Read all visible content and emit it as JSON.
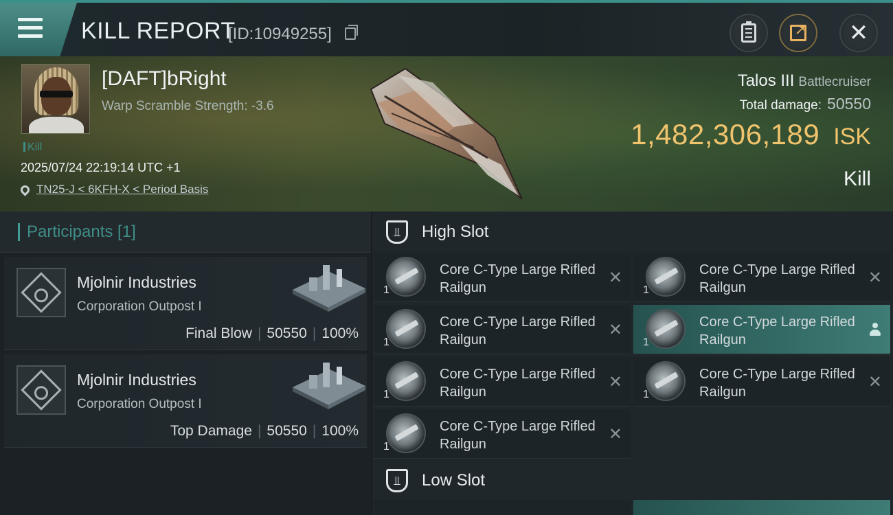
{
  "header": {
    "title": "KILL REPORT",
    "report_id": "[ID:10949255]"
  },
  "victim": {
    "pilot_name": "[DAFT]bRight",
    "warp_scramble": "Warp Scramble Strength: -3.6",
    "tag": "Kill",
    "timestamp": "2025/07/24 22:19:14 UTC +1",
    "location": "TN25-J < 6KFH-X < Period Basis"
  },
  "ship": {
    "name": "Talos III",
    "class": "Battlecruiser",
    "total_damage_label": "Total damage:",
    "total_damage": "50550",
    "isk_value": "1,482,306,189",
    "isk_unit": "ISK",
    "result": "Kill"
  },
  "participants": {
    "title": "Participants [1]",
    "items": [
      {
        "name": "Mjolnir Industries",
        "subtitle": "Corporation Outpost I",
        "role": "Final Blow",
        "damage": "50550",
        "percent": "100%"
      },
      {
        "name": "Mjolnir Industries",
        "subtitle": "Corporation Outpost I",
        "role": "Top Damage",
        "damage": "50550",
        "percent": "100%"
      }
    ]
  },
  "fitting": {
    "high_slot_title": "High Slot",
    "low_slot_title": "Low Slot",
    "modules": [
      {
        "name": "Core C-Type Large Rifled Railgun",
        "qty": "1"
      },
      {
        "name": "Core C-Type Large Rifled Railgun",
        "qty": "1"
      },
      {
        "name": "Core C-Type Large Rifled Railgun",
        "qty": "1"
      },
      {
        "name": "Core C-Type Large Rifled Railgun",
        "qty": "1"
      },
      {
        "name": "Core C-Type Large Rifled Railgun",
        "qty": "1"
      },
      {
        "name": "Core C-Type Large Rifled Railgun",
        "qty": "1"
      },
      {
        "name": "Core C-Type Large Rifled Railgun",
        "qty": "1"
      }
    ]
  },
  "icons": {
    "menu": "hamburger-icon",
    "copy": "copy-icon",
    "clipboard": "clipboard-icon",
    "share": "share-icon",
    "close": "close-icon",
    "location": "location-pin-icon",
    "slot": "slot-shield-icon",
    "remove": "close-x-icon",
    "user": "person-icon"
  },
  "colors": {
    "accent_teal": "#3f8e87",
    "isk_gold": "#f0c36d",
    "selected_row": "#3f7c76"
  }
}
